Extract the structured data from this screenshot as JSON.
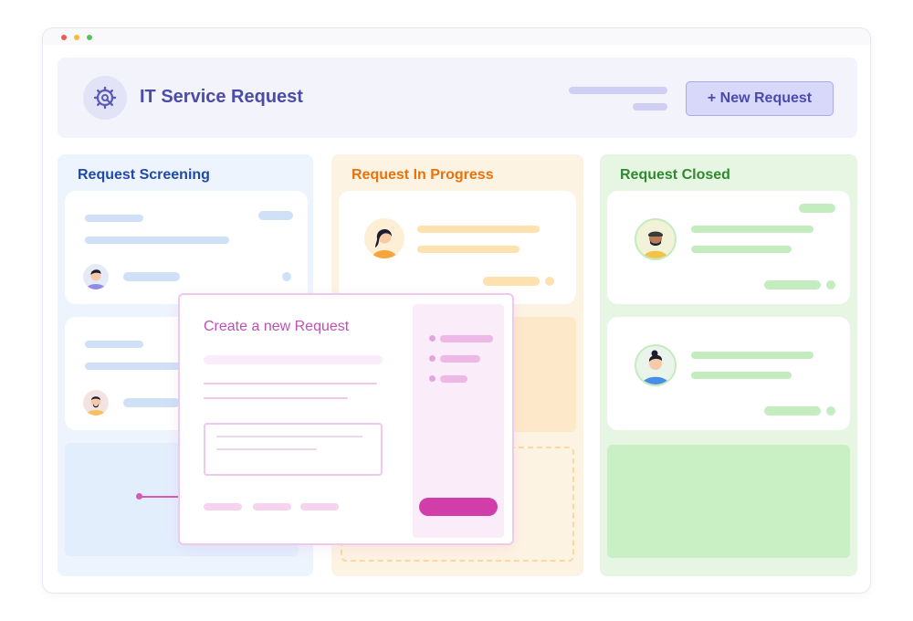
{
  "window": {
    "controls": [
      "close",
      "minimize",
      "maximize"
    ],
    "colors": {
      "close": "#f05a4f",
      "minimize": "#f4bb3c",
      "maximize": "#5ac25a"
    }
  },
  "header": {
    "icon": "wrench-gear-icon",
    "title": "IT Service Request",
    "new_request_label": "+ New Request"
  },
  "columns": [
    {
      "title": "Request Screening",
      "color": "#1f4aa8",
      "background": "#eef4fd",
      "accent": "#cfe0f7"
    },
    {
      "title": "Request In Progress",
      "color": "#e8720c",
      "background": "#fdf3e3",
      "accent": "#fde2b0"
    },
    {
      "title": "Request Closed",
      "color": "#2f8a2f",
      "background": "#e6f6e3",
      "accent": "#c3ecbf"
    }
  ],
  "modal": {
    "title": "Create a new Request",
    "accent": "#d23ea9"
  }
}
